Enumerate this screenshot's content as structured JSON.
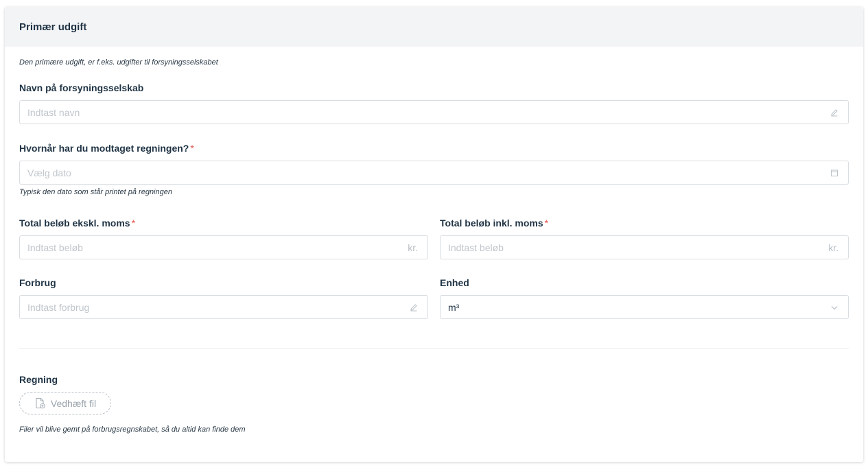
{
  "header": {
    "title": "Primær udgift"
  },
  "intro": "Den primære udgift, er f.eks. udgifter til forsyningsselskabet",
  "supplier": {
    "label": "Navn på forsyningsselskab",
    "placeholder": "Indtast navn",
    "icon": "pencil-icon"
  },
  "received_date": {
    "label": "Hvornår har du modtaget regningen?",
    "required_mark": "*",
    "placeholder": "Vælg dato",
    "icon": "calendar-icon",
    "hint": "Typisk den dato som står printet på regningen"
  },
  "total_excl": {
    "label": "Total beløb ekskl. moms",
    "required_mark": "*",
    "placeholder": "Indtast beløb",
    "suffix": "kr."
  },
  "total_incl": {
    "label": "Total beløb inkl. moms",
    "required_mark": "*",
    "placeholder": "Indtast beløb",
    "suffix": "kr."
  },
  "consumption": {
    "label": "Forbrug",
    "placeholder": "Indtast forbrug",
    "icon": "pencil-icon"
  },
  "unit": {
    "label": "Enhed",
    "value": "m³",
    "icon": "chevron-down-icon"
  },
  "bill": {
    "label": "Regning",
    "attach_label": "Vedhæft fil",
    "attach_icon": "file-add-icon",
    "hint": "Filer vil blive gemt på forbrugsregnskabet, så du altid kan finde dem"
  },
  "colors": {
    "header_bg": "#f3f4f6",
    "text": "#1f3344",
    "required": "#e5534b",
    "border": "#d9dde1",
    "placeholder": "#c0c6cc"
  }
}
